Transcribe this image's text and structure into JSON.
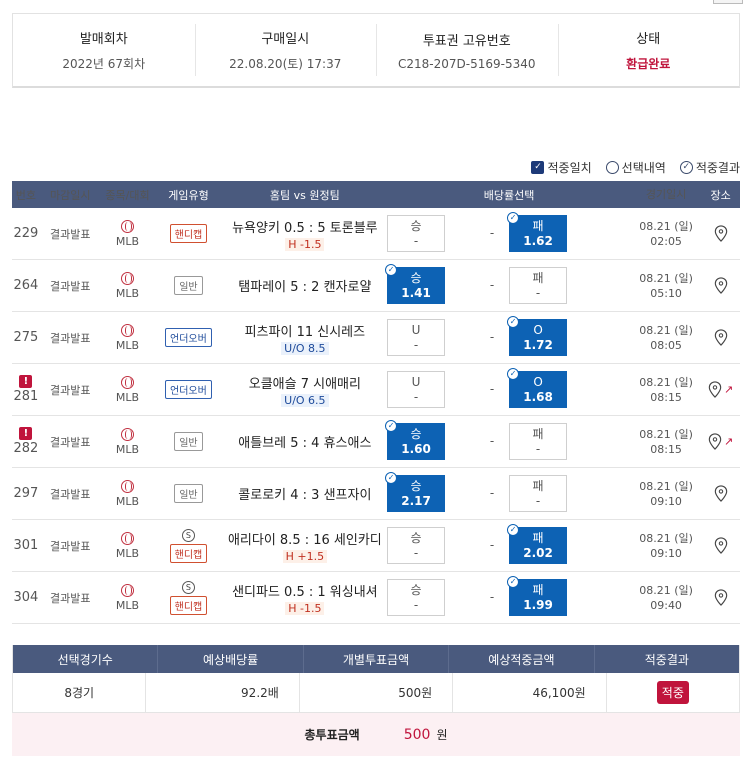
{
  "info": {
    "cells": [
      {
        "label": "발매회차",
        "value": "2022년 67회차"
      },
      {
        "label": "구매일시",
        "value": "22.08.20(토) 17:37"
      },
      {
        "label": "투표권 고유번호",
        "value": "C218-207D-5169-5340"
      },
      {
        "label": "상태",
        "value": "환급완료"
      }
    ]
  },
  "filters": [
    {
      "label": "적중일치",
      "checked": true
    },
    {
      "label": "선택내역",
      "checked": false
    },
    {
      "label": "적중결과",
      "checked": true
    }
  ],
  "games": {
    "headers": [
      "번호",
      "마감일시",
      "종목/대회",
      "게임유형",
      "홈팀 vs 원정팀",
      "배당률선택",
      "경기일시",
      "장소"
    ],
    "rows": [
      {
        "no": "229",
        "warn": false,
        "deadline": "결과발표",
        "league": "MLB",
        "type": "핸디캡",
        "special": false,
        "match": "뉴욕양키 0.5 : 5 토론블루",
        "sub": "H -1.5",
        "win": {
          "label": "승",
          "odds": "-"
        },
        "draw": "-",
        "lose": {
          "label": "패",
          "odds": "1.62"
        },
        "selected": "lose",
        "date": "08.21 (일)",
        "time": "02:05",
        "trend": false
      },
      {
        "no": "264",
        "warn": false,
        "deadline": "결과발표",
        "league": "MLB",
        "type": "일반",
        "special": false,
        "match": "탬파레이 5 : 2 캔자로얄",
        "sub": "",
        "win": {
          "label": "승",
          "odds": "1.41"
        },
        "draw": "-",
        "lose": {
          "label": "패",
          "odds": "-"
        },
        "selected": "win",
        "date": "08.21 (일)",
        "time": "05:10",
        "trend": false
      },
      {
        "no": "275",
        "warn": false,
        "deadline": "결과발표",
        "league": "MLB",
        "type": "언더오버",
        "special": false,
        "match": "피츠파이 11 신시레즈",
        "sub": "U/O 8.5",
        "win": {
          "label": "U",
          "odds": "-"
        },
        "draw": "-",
        "lose": {
          "label": "O",
          "odds": "1.72"
        },
        "selected": "lose",
        "date": "08.21 (일)",
        "time": "08:05",
        "trend": false
      },
      {
        "no": "281",
        "warn": true,
        "deadline": "결과발표",
        "league": "MLB",
        "type": "언더오버",
        "special": false,
        "match": "오클애슬 7 시애매리",
        "sub": "U/O 6.5",
        "win": {
          "label": "U",
          "odds": "-"
        },
        "draw": "-",
        "lose": {
          "label": "O",
          "odds": "1.68"
        },
        "selected": "lose",
        "date": "08.21 (일)",
        "time": "08:15",
        "trend": true
      },
      {
        "no": "282",
        "warn": true,
        "deadline": "결과발표",
        "league": "MLB",
        "type": "일반",
        "special": false,
        "match": "애틀브레 5 : 4 휴스애스",
        "sub": "",
        "win": {
          "label": "승",
          "odds": "1.60"
        },
        "draw": "-",
        "lose": {
          "label": "패",
          "odds": "-"
        },
        "selected": "win",
        "date": "08.21 (일)",
        "time": "08:15",
        "trend": true
      },
      {
        "no": "297",
        "warn": false,
        "deadline": "결과발표",
        "league": "MLB",
        "type": "일반",
        "special": false,
        "match": "콜로로키 4 : 3 샌프자이",
        "sub": "",
        "win": {
          "label": "승",
          "odds": "2.17"
        },
        "draw": "-",
        "lose": {
          "label": "패",
          "odds": "-"
        },
        "selected": "win",
        "date": "08.21 (일)",
        "time": "09:10",
        "trend": false
      },
      {
        "no": "301",
        "warn": false,
        "deadline": "결과발표",
        "league": "MLB",
        "type": "핸디캡",
        "special": true,
        "match": "애리다이 8.5 : 16 세인카디",
        "sub": "H +1.5",
        "win": {
          "label": "승",
          "odds": "-"
        },
        "draw": "-",
        "lose": {
          "label": "패",
          "odds": "2.02"
        },
        "selected": "lose",
        "date": "08.21 (일)",
        "time": "09:10",
        "trend": false
      },
      {
        "no": "304",
        "warn": false,
        "deadline": "결과발표",
        "league": "MLB",
        "type": "핸디캡",
        "special": true,
        "match": "샌디파드 0.5 : 1 워싱내셔",
        "sub": "H -1.5",
        "win": {
          "label": "승",
          "odds": "-"
        },
        "draw": "-",
        "lose": {
          "label": "패",
          "odds": "1.99"
        },
        "selected": "lose",
        "date": "08.21 (일)",
        "time": "09:40",
        "trend": false
      }
    ]
  },
  "summary": {
    "headers": [
      "선택경기수",
      "예상배당률",
      "개별투표금액",
      "예상적중금액",
      "적중결과"
    ],
    "games_count": "8경기",
    "odds": "92.2배",
    "bet": "500원",
    "expected": "46,100원",
    "result": "적중"
  },
  "total": {
    "label": "총투표금액",
    "value": "500",
    "unit": "원"
  },
  "icons": {
    "warn": "!",
    "special": "S",
    "check": "✓",
    "trend": "↗"
  },
  "colors": {
    "accent": "#0d62b4",
    "header": "#4a5a7e",
    "red": "#c0143c"
  }
}
